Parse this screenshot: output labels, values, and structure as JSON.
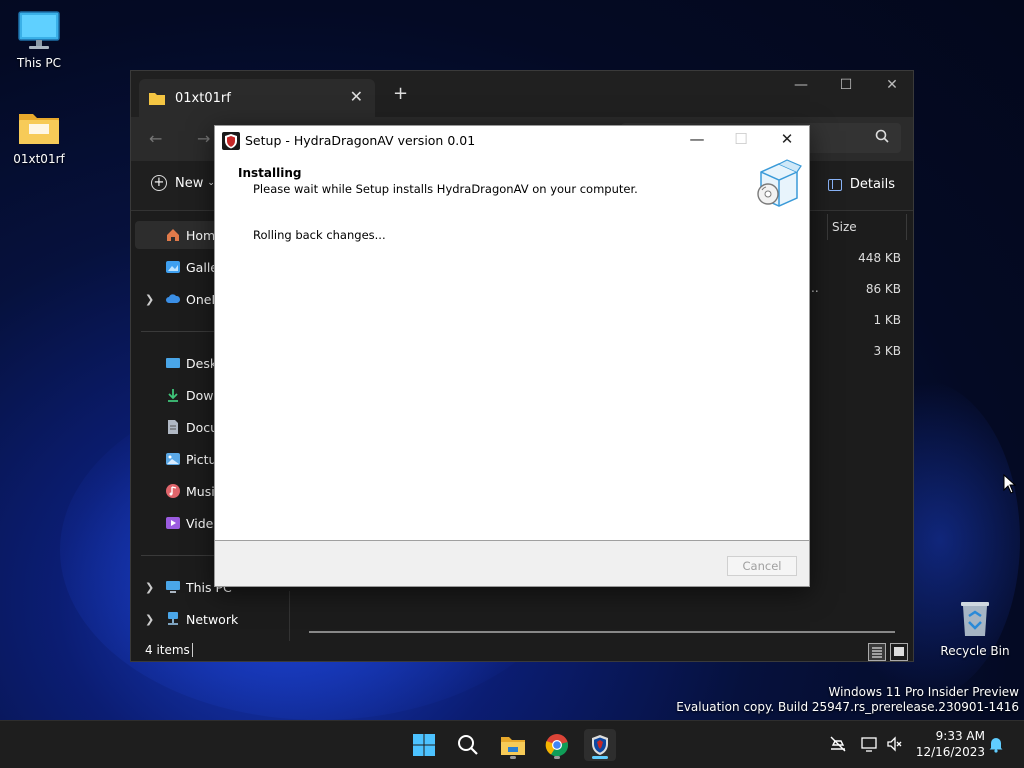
{
  "desktop": {
    "icons": [
      {
        "label": "This PC",
        "icon": "monitor-icon"
      },
      {
        "label": "01xt01rf",
        "icon": "folder-icon"
      },
      {
        "label": "Recycle Bin",
        "icon": "recycle-bin-icon"
      }
    ]
  },
  "explorer": {
    "tab_title": "01xt01rf",
    "new_label": "New",
    "details_label": "Details",
    "column_size": "Size",
    "sizes": [
      "448 KB",
      "86 KB",
      "1 KB",
      "3 KB"
    ],
    "truncated_name": "..",
    "sidebar": [
      {
        "label": "Home",
        "icon": "home-icon",
        "color": "#e07a4a"
      },
      {
        "label": "Galler",
        "icon": "gallery-icon",
        "color": "#3fa0f0"
      },
      {
        "label": "OneD",
        "icon": "cloud-icon",
        "color": "#3b8fe6"
      },
      {
        "label": "Deskt",
        "icon": "desktop-icon",
        "color": "#4aa6e8"
      },
      {
        "label": "Down",
        "icon": "download-icon",
        "color": "#3fc57a"
      },
      {
        "label": "Docu",
        "icon": "document-icon",
        "color": "#b0b8c4"
      },
      {
        "label": "Pictu",
        "icon": "pictures-icon",
        "color": "#5ba8e6"
      },
      {
        "label": "Music",
        "icon": "music-icon",
        "color": "#e0656b"
      },
      {
        "label": "Video",
        "icon": "video-icon",
        "color": "#9b5ce0"
      },
      {
        "label": "This PC",
        "icon": "computer-icon",
        "color": "#4aa6e8"
      },
      {
        "label": "Network",
        "icon": "network-icon",
        "color": "#4aa6e8"
      }
    ],
    "status_count": "4 items"
  },
  "setup": {
    "title": "Setup - HydraDragonAV version 0.01",
    "heading": "Installing",
    "subheading": "Please wait while Setup installs HydraDragonAV on your computer.",
    "status": "Rolling back changes...",
    "cancel_label": "Cancel"
  },
  "watermark": {
    "line1": "Windows 11 Pro Insider Preview",
    "line2": "Evaluation copy. Build 25947.rs_prerelease.230901-1416"
  },
  "taskbar": {
    "time": "9:33 AM",
    "date": "12/16/2023"
  },
  "colors": {
    "accent": "#60cdff",
    "folder": "#f4c542"
  }
}
